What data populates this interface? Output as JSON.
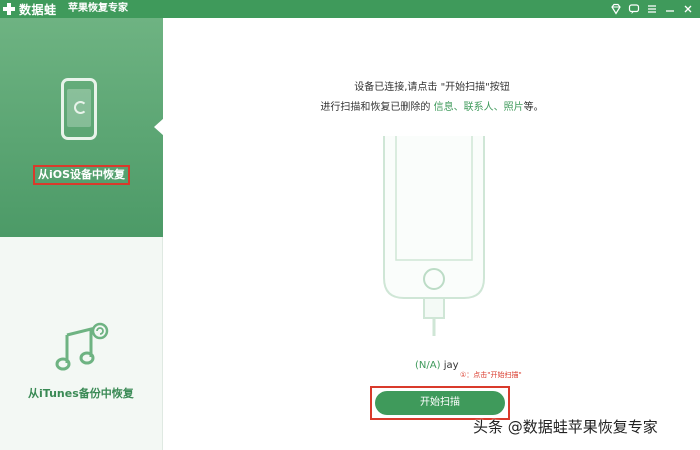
{
  "titlebar": {
    "logo_text": "数据蛙",
    "app_title": "苹果恢复专家",
    "controls": [
      "gem-icon",
      "chat-icon",
      "menu-icon",
      "minimize-icon",
      "close-icon"
    ]
  },
  "sidebar": {
    "items": [
      {
        "label": "从iOS设备中恢复",
        "icon": "iphone-sync-icon",
        "active": true
      },
      {
        "label": "从iTunes备份中恢复",
        "icon": "music-note-restore-icon",
        "active": false
      }
    ]
  },
  "main": {
    "hint_line1": "设备已连接,请点击 \"开始扫描\"按钮",
    "hint_line2_prefix": "进行扫描和恢复已删除的 ",
    "hint_line2_items": "信息、联系人、照片",
    "hint_line2_suffix": "等。",
    "device_status": "(N/A)",
    "device_name": "jay",
    "annotation": "①：点击\"开始扫描\"",
    "scan_button": "开始扫描"
  },
  "watermark": "头条 @数据蛙苹果恢复专家",
  "colors": {
    "brand_green": "#3f9a5b",
    "highlight_red": "#d93a2b"
  }
}
